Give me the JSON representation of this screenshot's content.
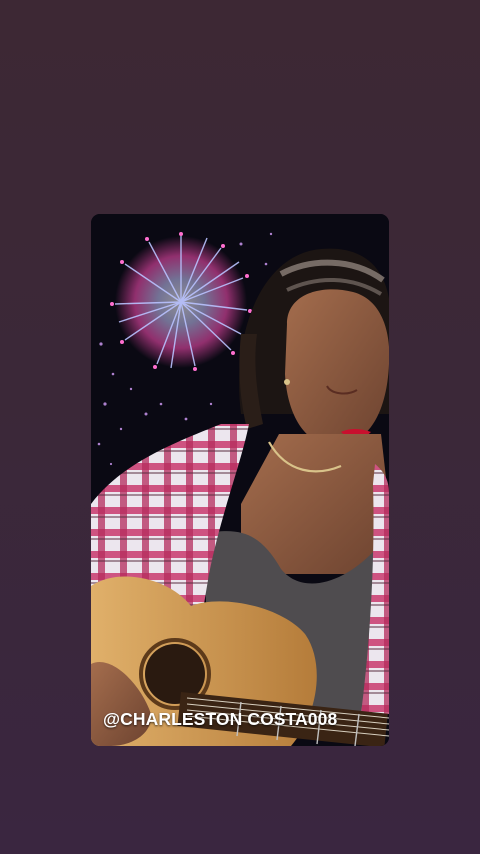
{
  "story": {
    "mention_text": "@CHARLESTON COSTA008"
  },
  "colors": {
    "page_background": "#3b2838",
    "firework_primary": "#9aa6ff",
    "firework_secondary": "#ff66cc",
    "lipstick": "#c8102e"
  }
}
